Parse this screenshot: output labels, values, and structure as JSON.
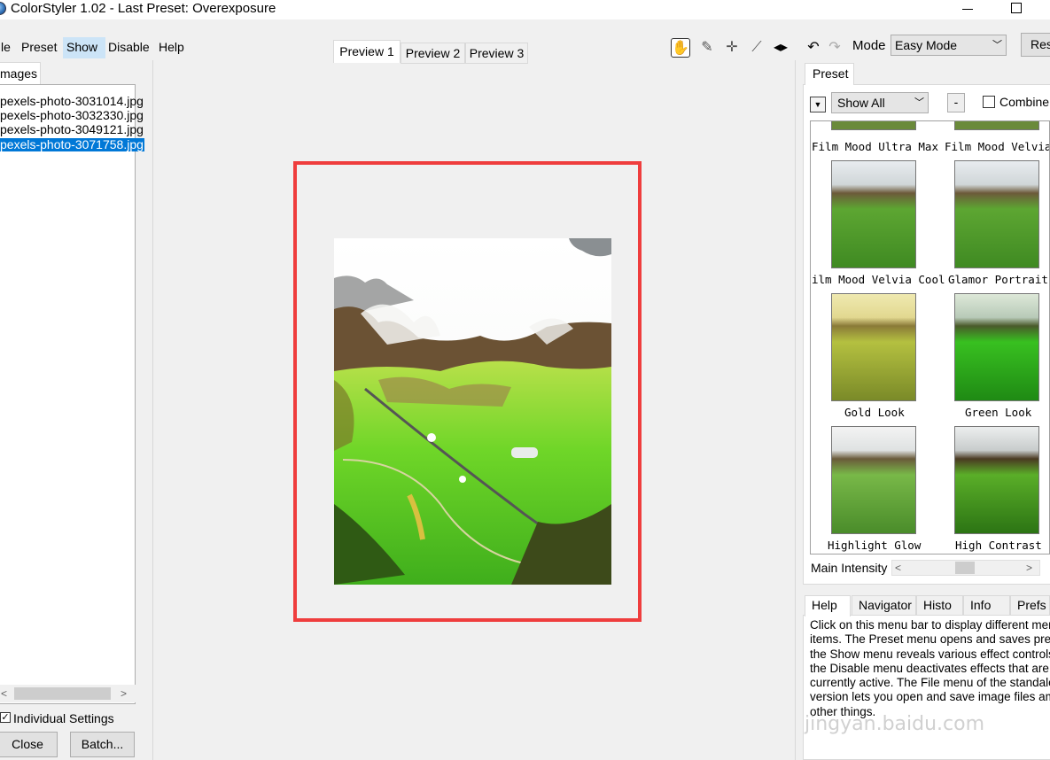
{
  "window": {
    "title": "ColorStyler 1.02 - Last Preset: Overexposure"
  },
  "menu": {
    "items": [
      {
        "label": "le"
      },
      {
        "label": "Preset"
      },
      {
        "label": "Show"
      },
      {
        "label": "Disable"
      },
      {
        "label": "Help"
      }
    ]
  },
  "left_panel": {
    "tab_label": "mages",
    "files": [
      "pexels-photo-3031014.jpg",
      "pexels-photo-3032330.jpg",
      "pexels-photo-3049121.jpg",
      "pexels-photo-3071758.jpg"
    ],
    "selected_file": "pexels-photo-3071758.jpg",
    "scroll_left": "<",
    "scroll_right": ">",
    "individual_settings_label": "Individual Settings",
    "individual_settings_checked": true,
    "close_label": "Close",
    "batch_label": "Batch..."
  },
  "preview": {
    "tabs": [
      {
        "label": "Preview 1"
      },
      {
        "label": "Preview 2"
      },
      {
        "label": "Preview 3"
      }
    ],
    "highlight_color": "#ef3d3d"
  },
  "toolbar": {
    "icons": [
      "hand-icon",
      "eyedropper-icon",
      "crosshair-icon",
      "brush-icon",
      "split-view-icon",
      "undo-icon",
      "redo-icon"
    ]
  },
  "mode": {
    "label": "Mode",
    "value": "Easy Mode",
    "reset_label": "Res"
  },
  "preset_panel": {
    "tab_label": "Preset",
    "filter_value": "Show All",
    "minus_label": "-",
    "combine_label": "Combine",
    "combine_checked": false,
    "presets": [
      {
        "label": "Film Mood Ultra Max"
      },
      {
        "label": "Film Mood Velvia"
      },
      {
        "label": "ilm Mood Velvia Cool"
      },
      {
        "label": "Glamor Portrait"
      },
      {
        "label": "Gold Look"
      },
      {
        "label": "Green Look"
      },
      {
        "label": "Highlight Glow"
      },
      {
        "label": "High Contrast"
      }
    ],
    "main_intensity_label": "Main Intensity",
    "slider_left": "<",
    "slider_right": ">"
  },
  "info_panel": {
    "tabs": [
      {
        "label": "Help"
      },
      {
        "label": "Navigator"
      },
      {
        "label": "Histo"
      },
      {
        "label": "Info"
      },
      {
        "label": "Prefs"
      }
    ],
    "help_text": "Click on this menu bar to display different menu\nitems. The Preset menu opens and saves pres\nthe Show menu reveals various effect controls\nthe Disable menu deactivates effects that are\ncurrently active. The File menu of the standalo\nversion lets you open and save image files am\nother things."
  },
  "watermark": "jingyan.baidu.com"
}
